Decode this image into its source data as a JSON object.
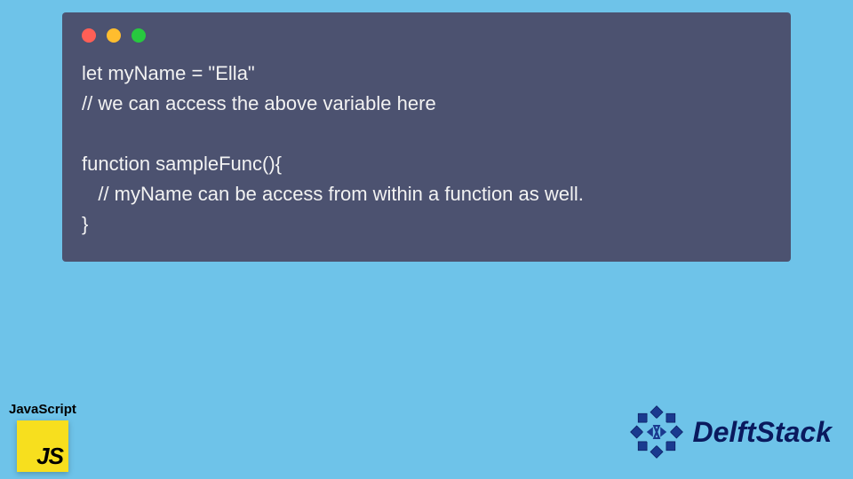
{
  "code_window": {
    "traffic_lights": [
      "red",
      "yellow",
      "green"
    ],
    "lines": [
      "let myName = \"Ella\"",
      "// we can access the above variable here",
      "",
      "function sampleFunc(){",
      "   // myName can be access from within a function as well.",
      "}"
    ]
  },
  "js_badge": {
    "label": "JavaScript",
    "icon_text": "JS"
  },
  "brand": {
    "name": "DelftStack"
  }
}
